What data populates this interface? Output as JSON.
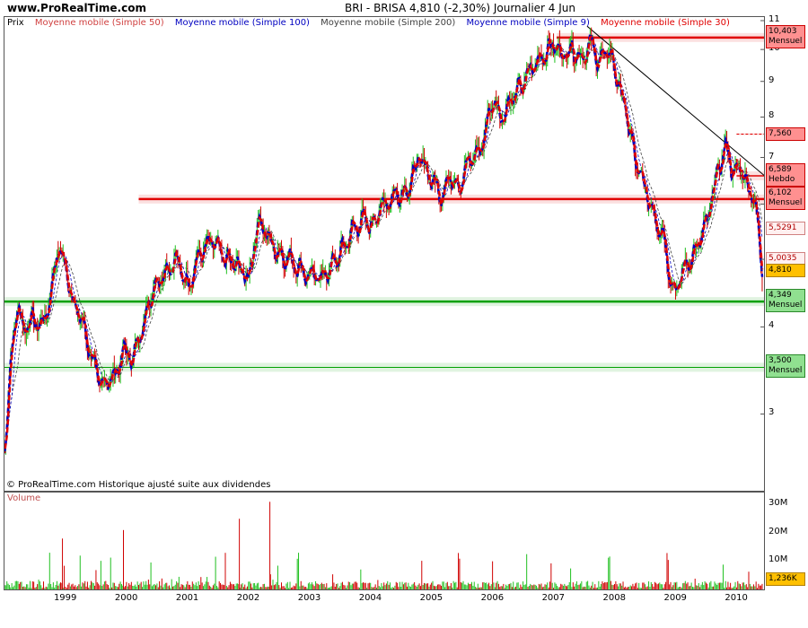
{
  "header": {
    "site": "www.ProRealTime.com",
    "instrument": "BRI - BRISA     4,810 (-2,30%)    Journalier  4 Jun"
  },
  "colors": {
    "ma50": "#d04040",
    "ma100": "#0000c0",
    "ma200": "#404040",
    "ma9": "#0000c0",
    "ma30": "#e00000",
    "up_candle": "#20c020",
    "down_candle": "#d00000",
    "resistance": "#e00000",
    "support": "#00a000",
    "trendline": "#000000"
  },
  "legend": {
    "prix": "Prix",
    "ma50": "Moyenne mobile (Simple 50)",
    "ma100": "Moyenne mobile (Simple 100)",
    "ma200": "Moyenne mobile (Simple 200)",
    "ma9": "Moyenne mobile (Simple 9)",
    "ma30": "Moyenne mobile (Simple 30)"
  },
  "footnote": "© ProRealTime.com Historique ajusté suite aux dividendes",
  "volume_panel": {
    "label": "Volume",
    "ticks": [
      {
        "label": "30M",
        "value": 30
      },
      {
        "label": "20M",
        "value": 20
      },
      {
        "label": "10M",
        "value": 10
      }
    ],
    "last_volume": "1,236K"
  },
  "price_tags": [
    {
      "value": "10,403",
      "note": "Mensuel",
      "style": "red",
      "price": 10.403
    },
    {
      "value": "7,560",
      "note": "",
      "style": "red",
      "price": 7.56
    },
    {
      "value": "6,589",
      "note": "Hebdo",
      "style": "red",
      "price": 6.589
    },
    {
      "value": "6,102",
      "note": "Mensuel",
      "style": "red",
      "price": 6.102
    },
    {
      "value": "5,5291",
      "note": "",
      "style": "pink",
      "price": 5.5291
    },
    {
      "value": "5,0035",
      "note": "",
      "style": "pink",
      "price": 5.0035
    },
    {
      "value": "4,810",
      "note": "",
      "style": "orange",
      "price": 4.81
    },
    {
      "value": "4,349",
      "note": "Mensuel",
      "style": "green",
      "price": 4.349
    },
    {
      "value": "3,500",
      "note": "Mensuel",
      "style": "green",
      "price": 3.5
    }
  ],
  "chart_data": {
    "type": "line",
    "title": "BRI - BRISA",
    "y_scale": "log",
    "ylim": [
      2.5,
      11
    ],
    "y_ticks": [
      3,
      4,
      5,
      6,
      7,
      8,
      9,
      10,
      11
    ],
    "xlim": [
      1998.0,
      2010.45
    ],
    "x_ticks": [
      "1999",
      "2000",
      "2001",
      "2002",
      "2003",
      "2004",
      "2005",
      "2006",
      "2007",
      "2008",
      "2009",
      "2010"
    ],
    "series": [
      {
        "name": "Prix",
        "x": [
          1998.0,
          1998.1,
          1998.2,
          1998.3,
          1998.45,
          1998.6,
          1998.75,
          1998.85,
          1999.0,
          1999.1,
          1999.25,
          1999.4,
          1999.55,
          1999.65,
          1999.8,
          1999.95,
          2000.1,
          2000.25,
          2000.45,
          2000.6,
          2000.8,
          2001.0,
          2001.2,
          2001.4,
          2001.6,
          2001.8,
          2002.0,
          2002.15,
          2002.35,
          2002.5,
          2002.7,
          2002.9,
          2003.1,
          2003.3,
          2003.5,
          2003.7,
          2003.85,
          2004.0,
          2004.2,
          2004.4,
          2004.6,
          2004.8,
          2005.0,
          2005.15,
          2005.3,
          2005.45,
          2005.6,
          2005.8,
          2006.0,
          2006.15,
          2006.3,
          2006.45,
          2006.6,
          2006.8,
          2007.0,
          2007.15,
          2007.3,
          2007.45,
          2007.6,
          2007.75,
          2007.9,
          2008.05,
          2008.2,
          2008.35,
          2008.5,
          2008.65,
          2008.8,
          2008.95,
          2009.05,
          2009.15,
          2009.3,
          2009.5,
          2009.7,
          2009.85,
          2009.95,
          2010.05,
          2010.15,
          2010.25,
          2010.35,
          2010.42
        ],
        "y": [
          2.7,
          3.6,
          4.3,
          4.0,
          4.1,
          4.0,
          4.4,
          5.2,
          4.9,
          4.4,
          4.1,
          3.7,
          3.3,
          3.35,
          3.4,
          3.7,
          3.6,
          4.0,
          4.6,
          4.8,
          5.0,
          4.6,
          5.1,
          5.3,
          5.0,
          4.9,
          4.7,
          5.7,
          5.3,
          5.1,
          5.0,
          4.8,
          4.7,
          4.8,
          5.1,
          5.5,
          5.7,
          5.6,
          6.0,
          6.2,
          6.3,
          7.0,
          6.5,
          6.2,
          6.6,
          6.4,
          6.9,
          7.2,
          8.5,
          8.0,
          8.5,
          8.8,
          9.3,
          9.8,
          10.2,
          9.8,
          10.1,
          9.7,
          10.2,
          9.6,
          10.0,
          9.0,
          8.0,
          6.8,
          6.3,
          5.8,
          5.4,
          4.5,
          4.6,
          4.9,
          5.1,
          5.6,
          6.8,
          7.3,
          6.5,
          6.9,
          6.4,
          6.3,
          5.5,
          4.81
        ]
      }
    ],
    "horizontal_levels": [
      {
        "value": 10.403,
        "label": "Mensuel",
        "color": "red"
      },
      {
        "value": 7.56,
        "label": "",
        "color": "red"
      },
      {
        "value": 6.589,
        "label": "Hebdo",
        "color": "red"
      },
      {
        "value": 6.102,
        "label": "Mensuel",
        "color": "red"
      },
      {
        "value": 4.349,
        "label": "Mensuel",
        "color": "green"
      },
      {
        "value": 3.5,
        "label": "Mensuel",
        "color": "green"
      }
    ],
    "trendline": {
      "x": [
        2007.55,
        2010.45
      ],
      "y": [
        10.8,
        6.6
      ]
    }
  }
}
